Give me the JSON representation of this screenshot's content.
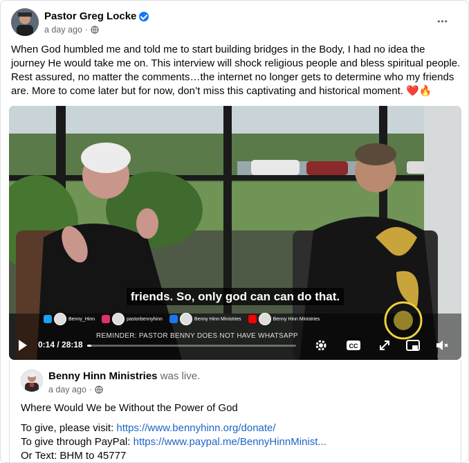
{
  "post": {
    "author": "Pastor Greg Locke",
    "time": "a day ago",
    "privacy_separator": "·",
    "more_label": "•••",
    "text": "When God humbled me and told me to start building bridges in the Body, I had no idea the journey He would take me on. This interview will shock religious people and bless spiritual people. Rest assured, no matter the comments…the internet no longer gets to determine who my friends are. More to come later but for now, don’t miss this captivating and historical moment. ❤️🔥"
  },
  "video": {
    "subtitle": "friends. So, only god can can do that.",
    "social": [
      {
        "platform": "twitter-icon",
        "label": "Benny_Hinn",
        "color": "#1da1f2"
      },
      {
        "platform": "instagram-icon",
        "label": "pastorbennyhinn",
        "color": "#e1306c"
      },
      {
        "platform": "facebook-icon",
        "label": "Benny Hinn Ministries",
        "color": "#1877f2"
      },
      {
        "platform": "youtube-icon",
        "label": "Benny Hinn Ministries",
        "color": "#ff0000"
      }
    ],
    "reminder": "REMINDER: PASTOR BENNY DOES NOT HAVE WHATSAPP",
    "timecode": "0:14 / 28:18",
    "progress_fraction": 0.008
  },
  "shared": {
    "name": "Benny Hinn Ministries",
    "status": "was live.",
    "time": "a day ago",
    "privacy_separator": "·",
    "title": "Where Would We be Without the Power of God",
    "give_label": "To give, please visit: ",
    "give_url": "https://www.bennyhinn.org/donate/",
    "paypal_label": "To give through PayPal: ",
    "paypal_url": "https://www.paypal.me/BennyHinnMinist...",
    "text_line": "Or Text: BHM to 45777"
  }
}
